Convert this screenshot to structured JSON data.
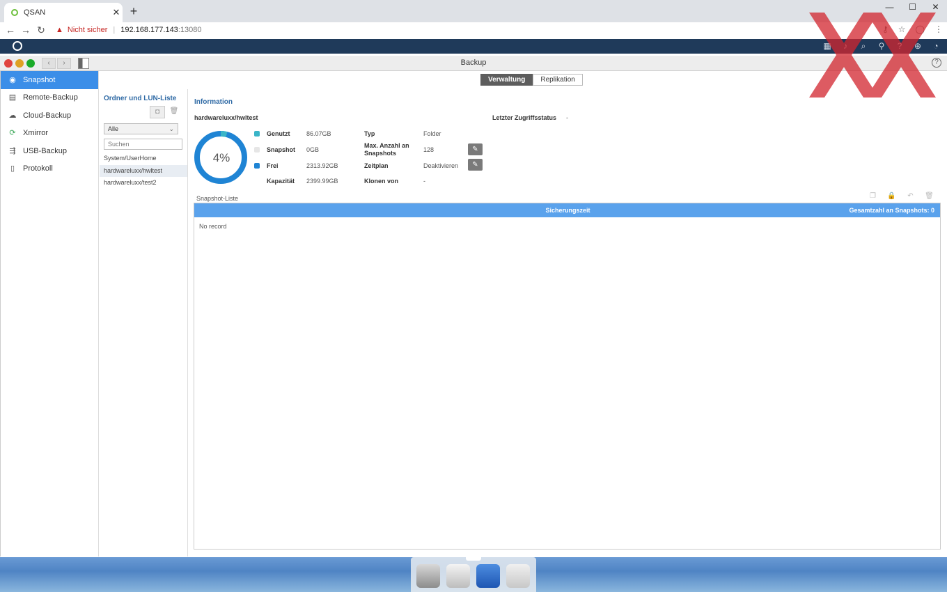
{
  "browser": {
    "tab_title": "QSAN",
    "new_tab": "+",
    "security_warning": "Nicht sicher",
    "url_host": "192.168.177.143",
    "url_port": ":13080"
  },
  "window": {
    "title": "Backup"
  },
  "sidebar": {
    "items": [
      {
        "label": "Snapshot",
        "icon": "camera-icon",
        "active": true
      },
      {
        "label": "Remote-Backup",
        "icon": "server-icon"
      },
      {
        "label": "Cloud-Backup",
        "icon": "cloud-icon"
      },
      {
        "label": "Xmirror",
        "icon": "sync-icon"
      },
      {
        "label": "USB-Backup",
        "icon": "usb-icon"
      },
      {
        "label": "Protokoll",
        "icon": "document-icon"
      }
    ]
  },
  "tabs": {
    "verwaltung": "Verwaltung",
    "replikation": "Replikation"
  },
  "folder_list": {
    "title": "Ordner und LUN-Liste",
    "filter": "Alle",
    "search_placeholder": "Suchen",
    "items": [
      "System/UserHome",
      "hardwareluxx/hwltest",
      "hardwareluxx/test2"
    ],
    "selected_index": 1
  },
  "info": {
    "title": "Information",
    "volume": "hardwareluxx/hwltest",
    "access_label": "Letzter Zugriffsstatus",
    "access_value": "-",
    "usage_percent": "4%",
    "usage_fraction": 0.04,
    "legend": {
      "used_label": "Genutzt",
      "used_value": "86.07GB",
      "snapshot_label": "Snapshot",
      "snapshot_value": "0GB",
      "free_label": "Frei",
      "free_value": "2313.92GB",
      "capacity_label": "Kapazität",
      "capacity_value": "2399.99GB"
    },
    "props": {
      "type_label": "Typ",
      "type_value": "Folder",
      "max_label": "Max. Anzahl an Snapshots",
      "max_value": "128",
      "schedule_label": "Zeitplan",
      "schedule_value": "Deaktivieren",
      "clone_label": "Klonen von",
      "clone_value": "-"
    }
  },
  "snapshot_list": {
    "label": "Snapshot-Liste",
    "col_time": "Sicherungszeit",
    "total": "Gesamtzahl an Snapshots: 0",
    "empty": "No record"
  },
  "colors": {
    "accent": "#3b8ee8",
    "used": "#3ab5c8",
    "free": "#1f84d4",
    "snapshot": "#e6e6e6",
    "header": "#5aa2ec"
  }
}
